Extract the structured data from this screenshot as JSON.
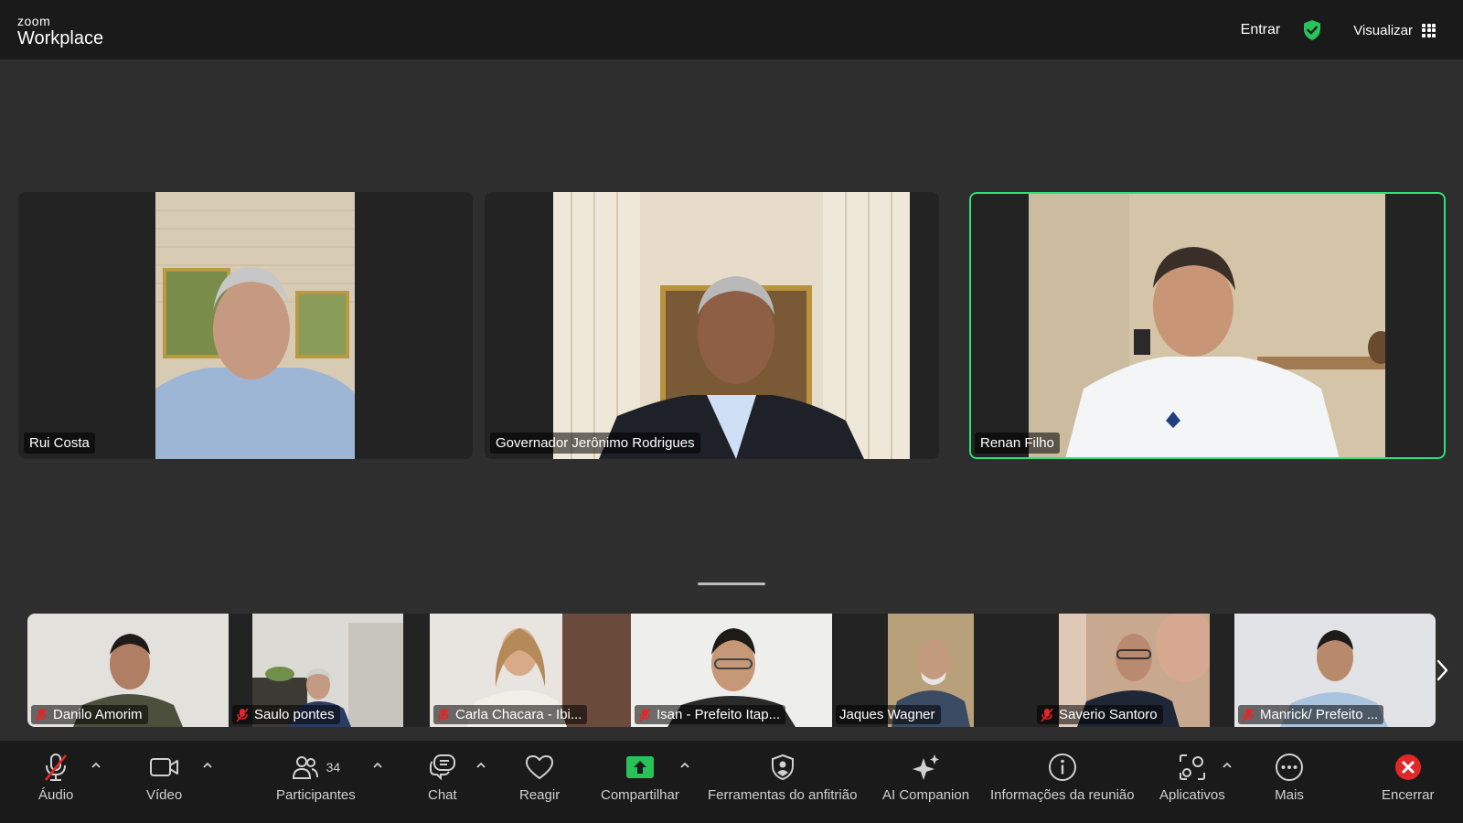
{
  "app": {
    "logo_line1": "zoom",
    "logo_line2": "Workplace"
  },
  "header": {
    "join_label": "Entrar",
    "view_label": "Visualizar",
    "security_color": "#27c35a"
  },
  "main_participants": [
    {
      "name": "Rui Costa",
      "active": false
    },
    {
      "name": "Governador Jerônimo Rodrigues",
      "active": false
    },
    {
      "name": "Renan Filho",
      "active": true
    }
  ],
  "gallery": [
    {
      "name": "Danilo Amorim",
      "muted": true
    },
    {
      "name": "Saulo pontes",
      "muted": true
    },
    {
      "name": "Carla Chacara - Ibi...",
      "muted": true
    },
    {
      "name": "Isan - Prefeito Itap...",
      "muted": true
    },
    {
      "name": "Jaques Wagner",
      "muted": false
    },
    {
      "name": "Saverio Santoro",
      "muted": true
    },
    {
      "name": "Manrick/ Prefeito ...",
      "muted": true
    }
  ],
  "toolbar": {
    "audio": "Áudio",
    "video": "Vídeo",
    "participants": "Participantes",
    "participants_count": "34",
    "chat": "Chat",
    "react": "Reagir",
    "share": "Compartilhar",
    "host_tools": "Ferramentas do anfitrião",
    "ai": "AI Companion",
    "info": "Informações da reunião",
    "apps": "Aplicativos",
    "more": "Mais",
    "end": "Encerrar"
  },
  "colors": {
    "share_green": "#27c35a",
    "end_red": "#e02828",
    "active_speaker": "#2ee27a"
  }
}
